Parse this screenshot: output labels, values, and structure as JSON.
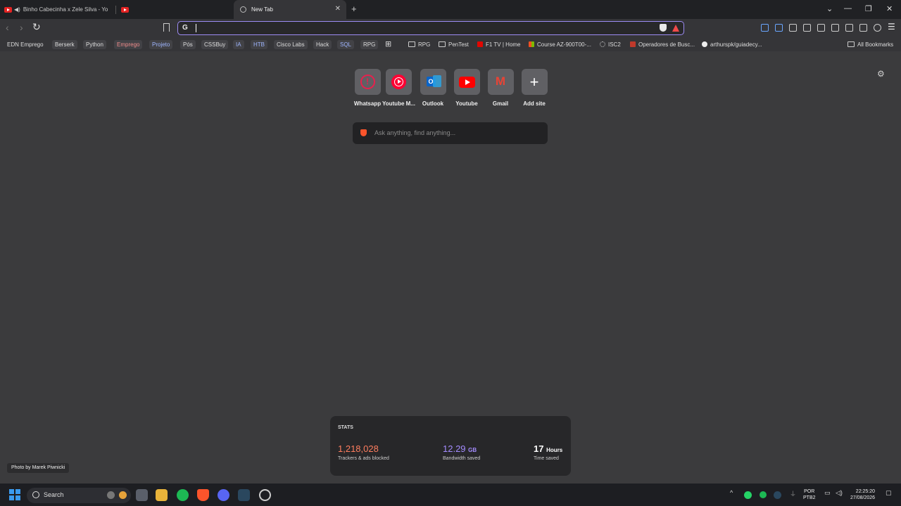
{
  "tabs": [
    {
      "title": "Binho Cabecinha x Zele Silva - Yo"
    },
    {
      "title": ""
    },
    {
      "title": "New Tab"
    }
  ],
  "omnibox": {
    "value": ""
  },
  "bookmarks": {
    "items": [
      {
        "label": "EDN Emprego",
        "color": "#dddddd"
      },
      {
        "label": "Berserk",
        "color": "#dddddd"
      },
      {
        "label": "Python",
        "color": "#dddddd"
      },
      {
        "label": "Emprego",
        "color": "#f08c8c"
      },
      {
        "label": "Projeto",
        "color": "#9fb6ff"
      },
      {
        "label": "Pós",
        "color": "#dddddd"
      },
      {
        "label": "CSSBuy",
        "color": "#dddddd"
      },
      {
        "label": "IA",
        "color": "#9fb6ff"
      },
      {
        "label": "HTB",
        "color": "#9fb6ff"
      },
      {
        "label": "Cisco Labs",
        "color": "#dddddd"
      },
      {
        "label": "Hack",
        "color": "#dddddd"
      },
      {
        "label": "SQL",
        "color": "#9fb6ff"
      },
      {
        "label": "RPG",
        "color": "#dddddd"
      }
    ],
    "folders": [
      {
        "label": "RPG"
      },
      {
        "label": "PenTest"
      }
    ],
    "links": [
      {
        "label": "F1 TV | Home",
        "icon": "f1-icon"
      },
      {
        "label": "Course AZ-900T00-...",
        "icon": "microsoft-icon"
      },
      {
        "label": "ISC2",
        "icon": "isc2-icon"
      },
      {
        "label": "Operadores de Busc...",
        "icon": "red-icon"
      },
      {
        "label": "arthurspk/guiadecy...",
        "icon": "github-icon"
      }
    ],
    "all_bookmarks": "All Bookmarks"
  },
  "top_sites": [
    {
      "label": "Whatsapp",
      "icon": "alert-icon",
      "color": "#e8204d"
    },
    {
      "label": "Youtube M...",
      "icon": "youtube-music-icon",
      "color": "#ff0033"
    },
    {
      "label": "Outlook",
      "icon": "outlook-icon",
      "color": "#1a73e8"
    },
    {
      "label": "Youtube",
      "icon": "youtube-icon",
      "color": "#ff0000"
    },
    {
      "label": "Gmail",
      "icon": "gmail-icon",
      "color": "#ea4335"
    },
    {
      "label": "Add site",
      "icon": "plus-icon",
      "color": "#ffffff"
    }
  ],
  "search": {
    "placeholder": "Ask anything, find anything..."
  },
  "photo_credit": "Photo by Marek Piwnicki",
  "stats": {
    "title": "STATS",
    "trackers": {
      "value": "1,218,028",
      "label": "Trackers & ads blocked",
      "color": "#ff7e5f"
    },
    "bandwidth": {
      "value": "12.29",
      "unit": "GB",
      "label": "Bandwidth saved",
      "color": "#a48cff"
    },
    "time": {
      "value": "17",
      "unit": "Hours",
      "label": "Time saved"
    }
  },
  "taskbar": {
    "search_label": "Search",
    "lang": "POR",
    "lang2": "PTB2",
    "time": "22:25:20",
    "date": "27/08/2026"
  }
}
